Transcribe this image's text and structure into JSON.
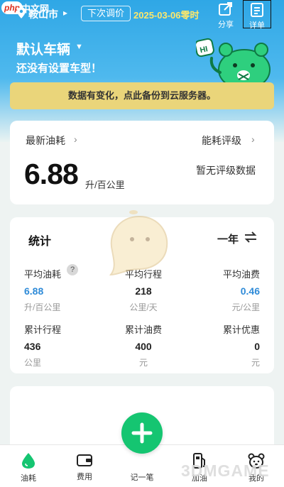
{
  "watermark_badge": "php",
  "watermark_site": "中文网",
  "header": {
    "city": "鞍山市",
    "price_button": "下次调价",
    "price_date": "2025-03-06零时",
    "share_label": "分享",
    "detail_label": "详单"
  },
  "vehicle": {
    "title": "默认车辆",
    "subtitle": "还没有设置车型！"
  },
  "notice": "数据有变化，点此备份到云服务器。",
  "fuel": {
    "latest_label": "最新油耗",
    "latest_value": "6.88",
    "latest_unit": "升/百公里",
    "rating_label": "能耗评级",
    "rating_value": "暂无评级数据"
  },
  "stats": {
    "title": "统计",
    "period": "一年",
    "help": "?",
    "items": [
      {
        "label": "平均油耗",
        "value": "6.88",
        "unit": "升/百公里"
      },
      {
        "label": "平均行程",
        "value": "218",
        "unit": "公里/天"
      },
      {
        "label": "平均油费",
        "value": "0.46",
        "unit": "元/公里"
      },
      {
        "label": "累计行程",
        "value": "436",
        "unit": "公里"
      },
      {
        "label": "累计油费",
        "value": "400",
        "unit": "元"
      },
      {
        "label": "累计优惠",
        "value": "0",
        "unit": "元"
      }
    ]
  },
  "nav": {
    "fuel": "油耗",
    "cost": "费用",
    "record": "记一笔",
    "refuel": "加油",
    "mine": "我的"
  },
  "mascot_sign": "HI",
  "watermark_game": "3DMGAME",
  "colors": {
    "accent_green": "#15c571",
    "header_blue": "#2fa7e6",
    "notice_yellow": "#ead57a",
    "value_blue": "#2f8bd8",
    "date_yellow": "#ffe86a"
  }
}
